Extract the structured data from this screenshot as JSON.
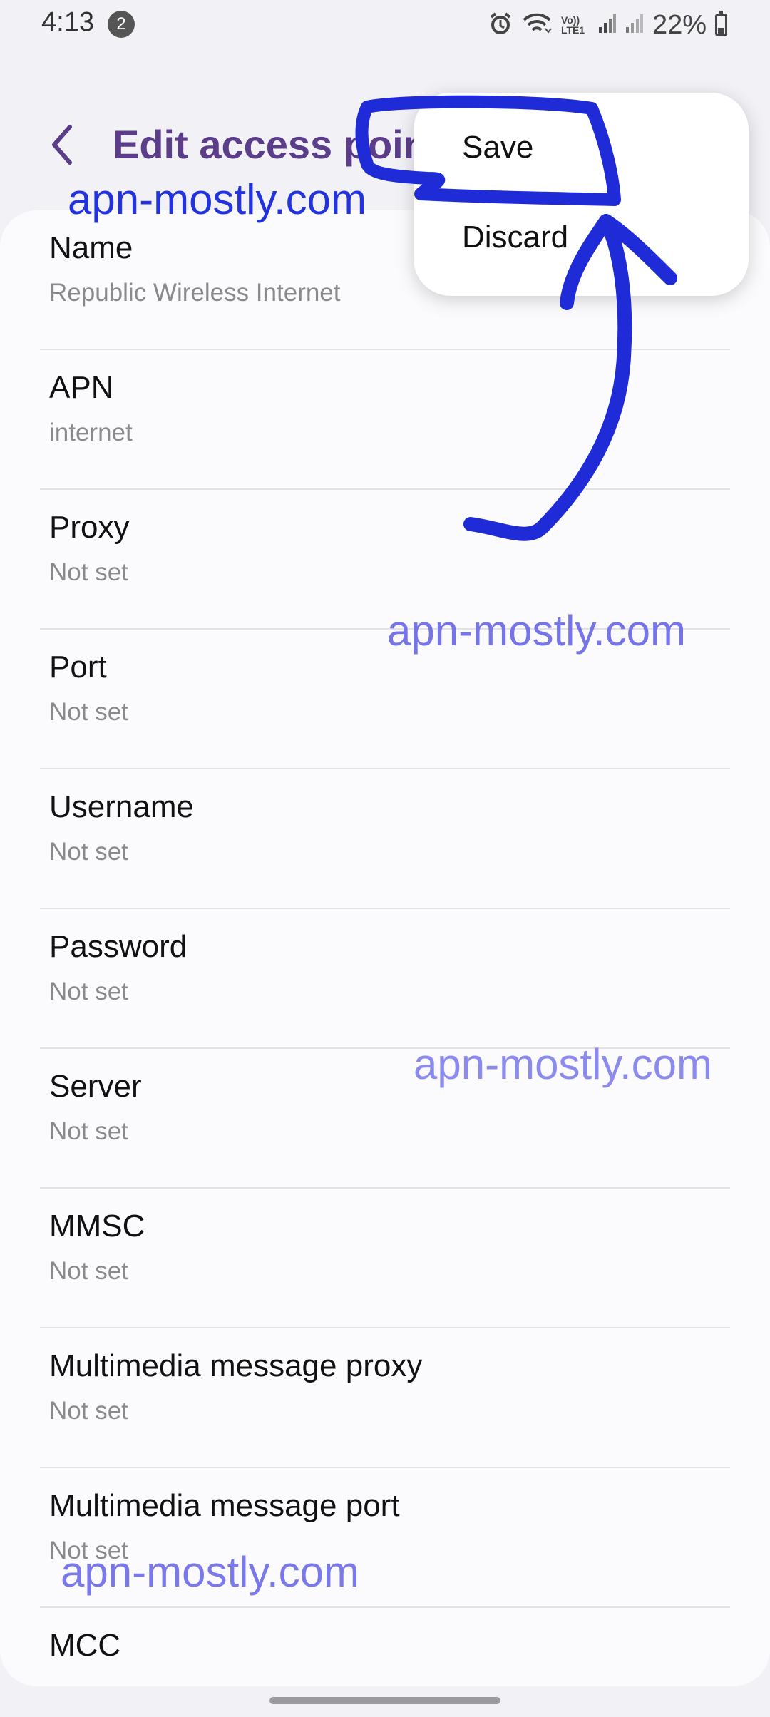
{
  "status_bar": {
    "time": "4:13",
    "notification_count": "2",
    "battery": "22%",
    "volte_label": "Vo)) LTE1"
  },
  "header": {
    "title": "Edit access point"
  },
  "menu": {
    "save": "Save",
    "discard": "Discard"
  },
  "fields": [
    {
      "label": "Name",
      "value": "Republic Wireless Internet"
    },
    {
      "label": "APN",
      "value": "internet"
    },
    {
      "label": "Proxy",
      "value": "Not set"
    },
    {
      "label": "Port",
      "value": "Not set"
    },
    {
      "label": "Username",
      "value": "Not set"
    },
    {
      "label": "Password",
      "value": "Not set"
    },
    {
      "label": "Server",
      "value": "Not set"
    },
    {
      "label": "MMSC",
      "value": "Not set"
    },
    {
      "label": "Multimedia message proxy",
      "value": "Not set"
    },
    {
      "label": "Multimedia message port",
      "value": "Not set"
    },
    {
      "label": "MCC",
      "value": ""
    }
  ],
  "watermarks": [
    "apn-mostly.com",
    "apn-mostly.com",
    "apn-mostly.com",
    "apn-mostly.com"
  ],
  "colors": {
    "title": "#5b3d8a",
    "annotation": "#1f2bd6",
    "background": "#f2f2f6"
  }
}
